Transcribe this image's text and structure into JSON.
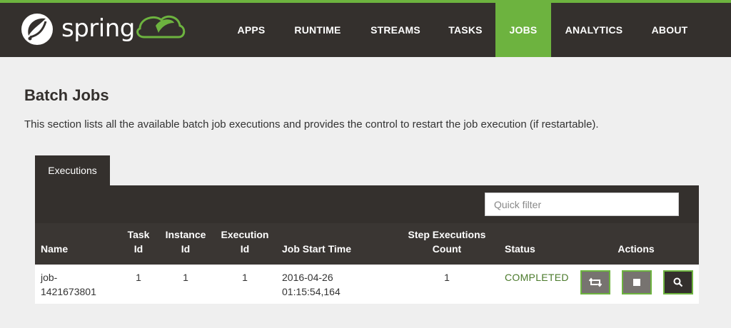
{
  "brand": {
    "name": "spring",
    "accent": "#6db33f",
    "dark": "#34302d"
  },
  "nav": [
    {
      "label": "APPS",
      "active": false
    },
    {
      "label": "RUNTIME",
      "active": false
    },
    {
      "label": "STREAMS",
      "active": false
    },
    {
      "label": "TASKS",
      "active": false
    },
    {
      "label": "JOBS",
      "active": true
    },
    {
      "label": "ANALYTICS",
      "active": false
    },
    {
      "label": "ABOUT",
      "active": false
    }
  ],
  "page": {
    "title": "Batch Jobs",
    "description": "This section lists all the available batch job executions and provides the control to restart the job execution (if restartable)."
  },
  "tabs": [
    {
      "label": "Executions",
      "active": true
    }
  ],
  "filter": {
    "placeholder": "Quick filter",
    "value": ""
  },
  "table": {
    "columns": {
      "name": "Name",
      "task_id": [
        "Task",
        "Id"
      ],
      "instance_id": [
        "Instance",
        "Id"
      ],
      "execution_id": [
        "Execution",
        "Id"
      ],
      "start_time": "Job Start Time",
      "step_count": [
        "Step Executions",
        "Count"
      ],
      "status": "Status",
      "actions": "Actions"
    },
    "rows": [
      {
        "name": [
          "job-",
          "1421673801"
        ],
        "task_id": "1",
        "instance_id": "1",
        "execution_id": "1",
        "start_time": [
          "2016-04-26",
          "01:15:54,164"
        ],
        "step_count": "1",
        "status": "COMPLETED",
        "status_color": "#4b7a2b",
        "actions": [
          {
            "name": "restart",
            "icon": "retweet-icon"
          },
          {
            "name": "stop",
            "icon": "stop-icon"
          },
          {
            "name": "details",
            "icon": "search-icon"
          }
        ]
      }
    ]
  }
}
